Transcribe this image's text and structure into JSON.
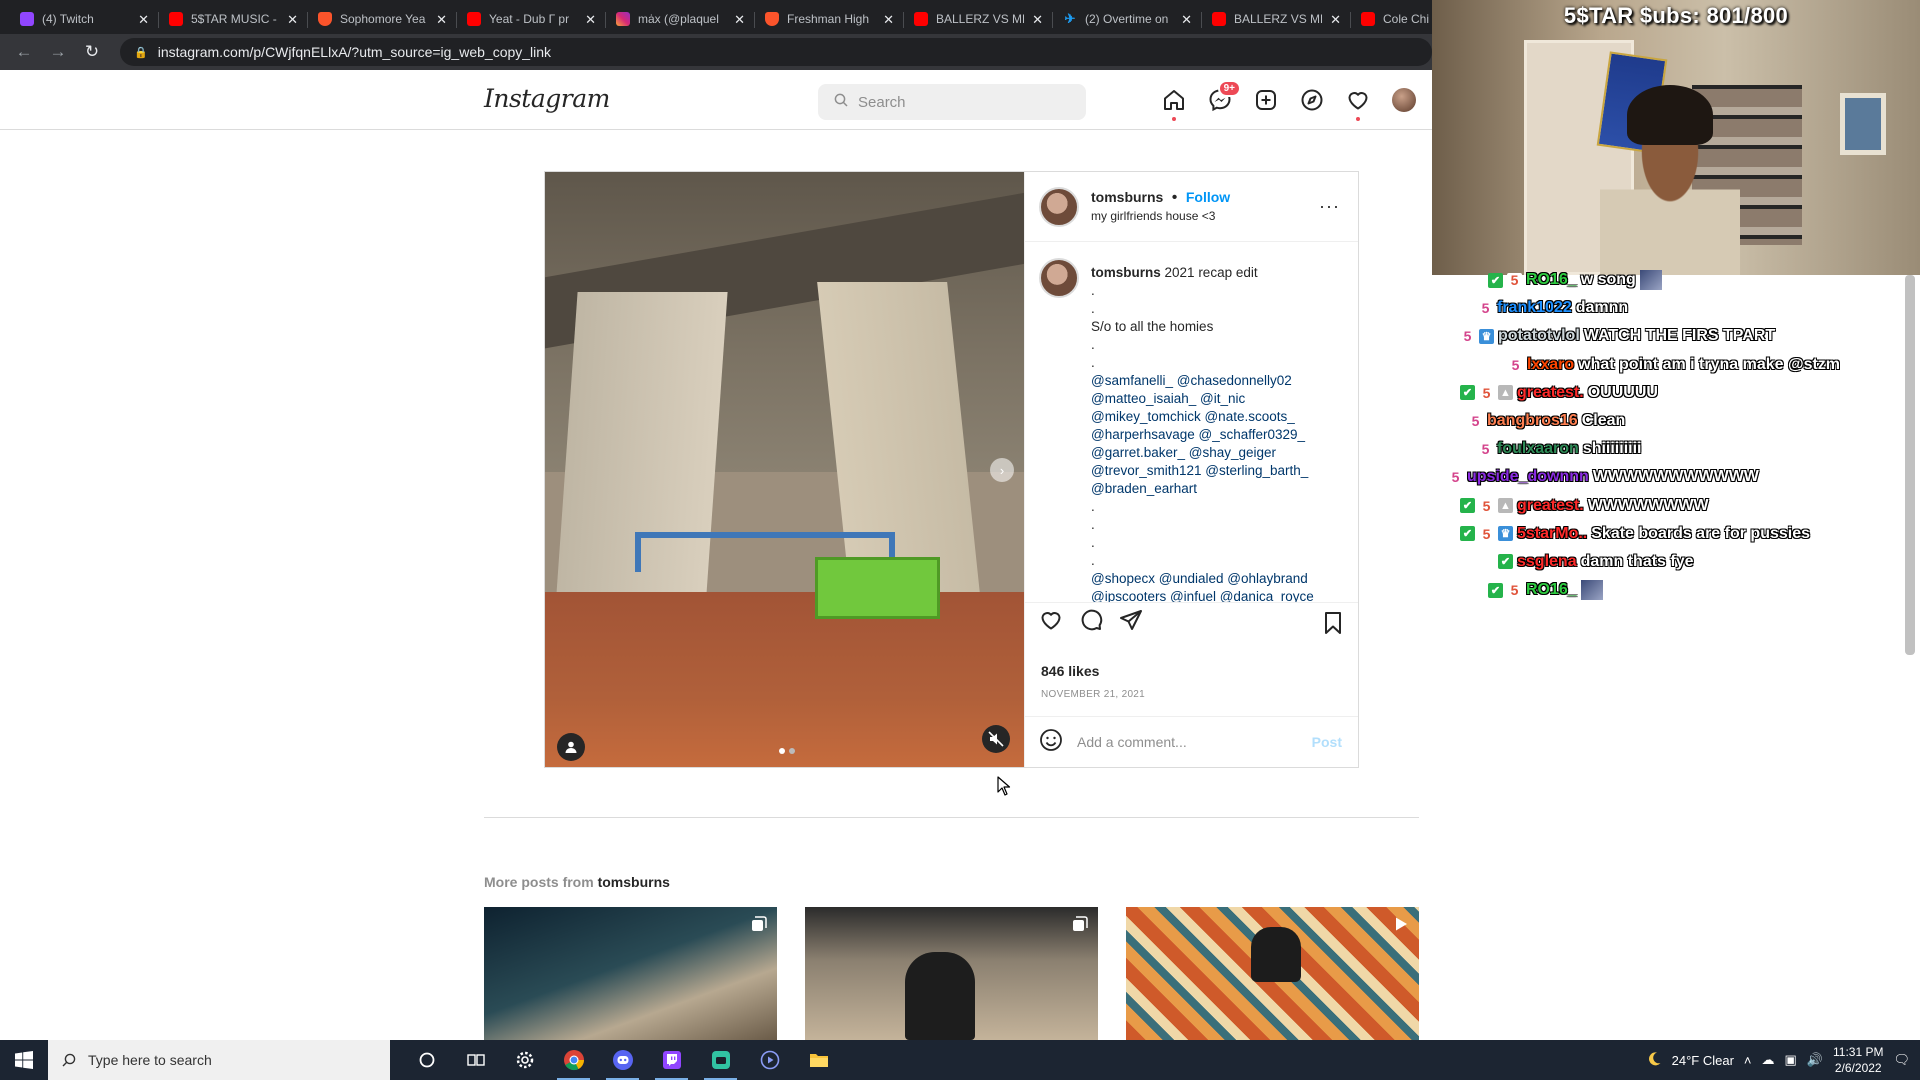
{
  "browser": {
    "tabs": [
      {
        "title": "(4) Twitch",
        "icon": "twitch-icon"
      },
      {
        "title": "5$TAR MUSIC -",
        "icon": "youtube-icon"
      },
      {
        "title": "Sophomore Yea",
        "icon": "brave-icon"
      },
      {
        "title": "Yeat - Dub Г pr",
        "icon": "youtube-icon"
      },
      {
        "title": "mȧx (@plaquel",
        "icon": "instagram-icon"
      },
      {
        "title": "Freshman High",
        "icon": "brave-icon"
      },
      {
        "title": "BALLERZ VS ME",
        "icon": "youtube-icon"
      },
      {
        "title": "(2) Overtime on",
        "icon": "twitter-icon"
      },
      {
        "title": "BALLERZ VS ME",
        "icon": "youtube-icon"
      },
      {
        "title": "Cole Chi",
        "icon": "youtube-icon"
      }
    ],
    "url": "instagram.com/p/CWjfqnELlxA/?utm_source=ig_web_copy_link"
  },
  "instagram": {
    "logo": "Instagram",
    "search_placeholder": "Search",
    "messages_badge": "9+",
    "post": {
      "username": "tomsburns",
      "separator": "•",
      "follow_label": "Follow",
      "location": "my girlfriends house <3",
      "more": "···",
      "caption_user": "tomsburns",
      "caption_lines": [
        {
          "text": "2021 recap edit",
          "first": true
        },
        {
          "text": "."
        },
        {
          "text": "."
        },
        {
          "text": "S/o to all the homies"
        },
        {
          "text": "."
        },
        {
          "text": "."
        },
        {
          "text": "@samfanelli_ @chasedonnelly02"
        },
        {
          "text": "@matteo_isaiah_ @it_nic"
        },
        {
          "text": "@mikey_tomchick @nate.scoots_"
        },
        {
          "text": "@harperhsavage @_schaffer0329_"
        },
        {
          "text": "@garret.baker_ @shay_geiger"
        },
        {
          "text": "@trevor_smith121 @sterling_barth_"
        },
        {
          "text": "@braden_earhart"
        },
        {
          "text": "."
        },
        {
          "text": "."
        },
        {
          "text": "."
        },
        {
          "text": "."
        },
        {
          "text": "@shopecx @undialed @ohlaybrand"
        },
        {
          "text": "@ipscooters @infuel @danica_royce"
        }
      ],
      "likes": "846 likes",
      "date": "NOVEMBER 21, 2021",
      "comment_placeholder": "Add a comment...",
      "post_button": "Post",
      "carousel_index": 1,
      "carousel_total": 2
    },
    "more_posts": {
      "prefix": "More posts from",
      "user": "tomsburns"
    }
  },
  "stream": {
    "subs_text": "5$TAR $ubs: 801/800",
    "chat": [
      {
        "badges": [
          "chk",
          "sub2"
        ],
        "name": "RO16_",
        "color": "#2ecc40",
        "msg": "w song",
        "emote": true
      },
      {
        "badges": [
          "sub"
        ],
        "name": "frank1022",
        "color": "#1e90ff",
        "msg": "damnn"
      },
      {
        "badges": [
          "sub",
          "crown"
        ],
        "name": "potatotvlol",
        "color": "#cfd8dc",
        "msg": "WATCH THE FIRS TPART"
      },
      {
        "badges": [
          "sub"
        ],
        "name": "lxxaro",
        "color": "#ff4500",
        "msg": "what point am i tryna make @stzm"
      },
      {
        "badges": [
          "chk",
          "sub2",
          "tri"
        ],
        "name": "greatest.",
        "color": "#ff2a2a",
        "msg": "OUUUUU"
      },
      {
        "badges": [
          "sub"
        ],
        "name": "bangbros16",
        "color": "#ff7f50",
        "msg": "Clean"
      },
      {
        "badges": [
          "sub"
        ],
        "name": "foulxaaron",
        "color": "#2e8b57",
        "msg": "shiiiiiiiii"
      },
      {
        "badges": [
          "sub"
        ],
        "name": "upside_downnn",
        "color": "#8a2be2",
        "msg": "WWWWWWWWWWW"
      },
      {
        "badges": [
          "chk",
          "sub2",
          "tri"
        ],
        "name": "greatest.",
        "color": "#ff2a2a",
        "msg": "WWWWWWWW"
      },
      {
        "badges": [
          "chk",
          "sub2",
          "crown"
        ],
        "name": "5starMo..",
        "color": "#ff2a2a",
        "msg": "Skate boards are for pussies"
      },
      {
        "badges": [
          "chk"
        ],
        "name": "ssglena",
        "color": "#ff2a2a",
        "msg": "damn thats fye"
      },
      {
        "badges": [
          "chk",
          "sub2"
        ],
        "name": "RO16_",
        "color": "#2ecc40",
        "msg": "",
        "emote": true
      }
    ]
  },
  "taskbar": {
    "search_placeholder": "Type here to search",
    "weather": "24°F  Clear",
    "time": "11:31 PM",
    "date": "2/6/2022"
  }
}
